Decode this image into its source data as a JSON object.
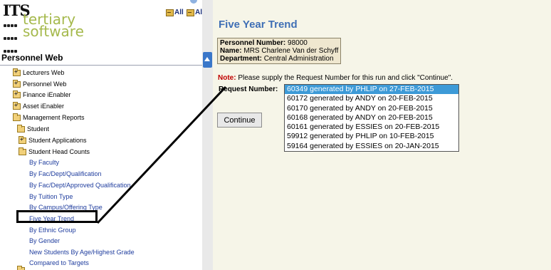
{
  "logo": {
    "its": "ITS",
    "line1": "tertiary",
    "line2": "software"
  },
  "toolbar": {
    "expand_all": "All",
    "collapse_all": "All"
  },
  "sidebar": {
    "title": "Personnel Web",
    "items": [
      {
        "label": "Lecturers Web"
      },
      {
        "label": "Personnel Web"
      },
      {
        "label": "Finance iEnabler"
      },
      {
        "label": "Asset iEnabler"
      },
      {
        "label": "Management Reports"
      },
      {
        "label": "Student"
      },
      {
        "label": "Student Applications"
      },
      {
        "label": "Student Head Counts"
      },
      {
        "label": "By Faculty"
      },
      {
        "label": "By Fac/Dept/Qualification"
      },
      {
        "label": "By Fac/Dept/Approved Qualification"
      },
      {
        "label": "By Tuition Type"
      },
      {
        "label": "By Campus/Offering Type"
      },
      {
        "label": "Five Year Trend"
      },
      {
        "label": "By Ethnic Group"
      },
      {
        "label": "By Gender"
      },
      {
        "label": "New Students By Age/Highest Grade"
      },
      {
        "label": "Compared to Targets"
      }
    ]
  },
  "main": {
    "title": "Five Year Trend",
    "personnel_number_label": "Personnel Number:",
    "personnel_number": "98000",
    "name_label": "Name:",
    "name": "MRS Charlene Van der Schyff",
    "department_label": "Department:",
    "department": "Central Administration",
    "note_label": "Note:",
    "note_text": "Please supply the Request Number for this run and click \"Continue\".",
    "request_label": "Request Number:",
    "request_options": [
      "60349 generated by PHLIP on 27-FEB-2015",
      "60172 generated by ANDY on 20-FEB-2015",
      "60170 generated by ANDY on 20-FEB-2015",
      "60168 generated by ANDY on 20-FEB-2015",
      "60161 generated by ESSIES on 20-FEB-2015",
      "59912 generated by PHLIP on 10-FEB-2015",
      "59164 generated by ESSIES on 20-JAN-2015"
    ],
    "continue_label": "Continue"
  },
  "colors": {
    "accent": "#3f6fb5",
    "selected": "#3d9ad7",
    "note": "#c00000",
    "link": "#1f3d9e"
  }
}
